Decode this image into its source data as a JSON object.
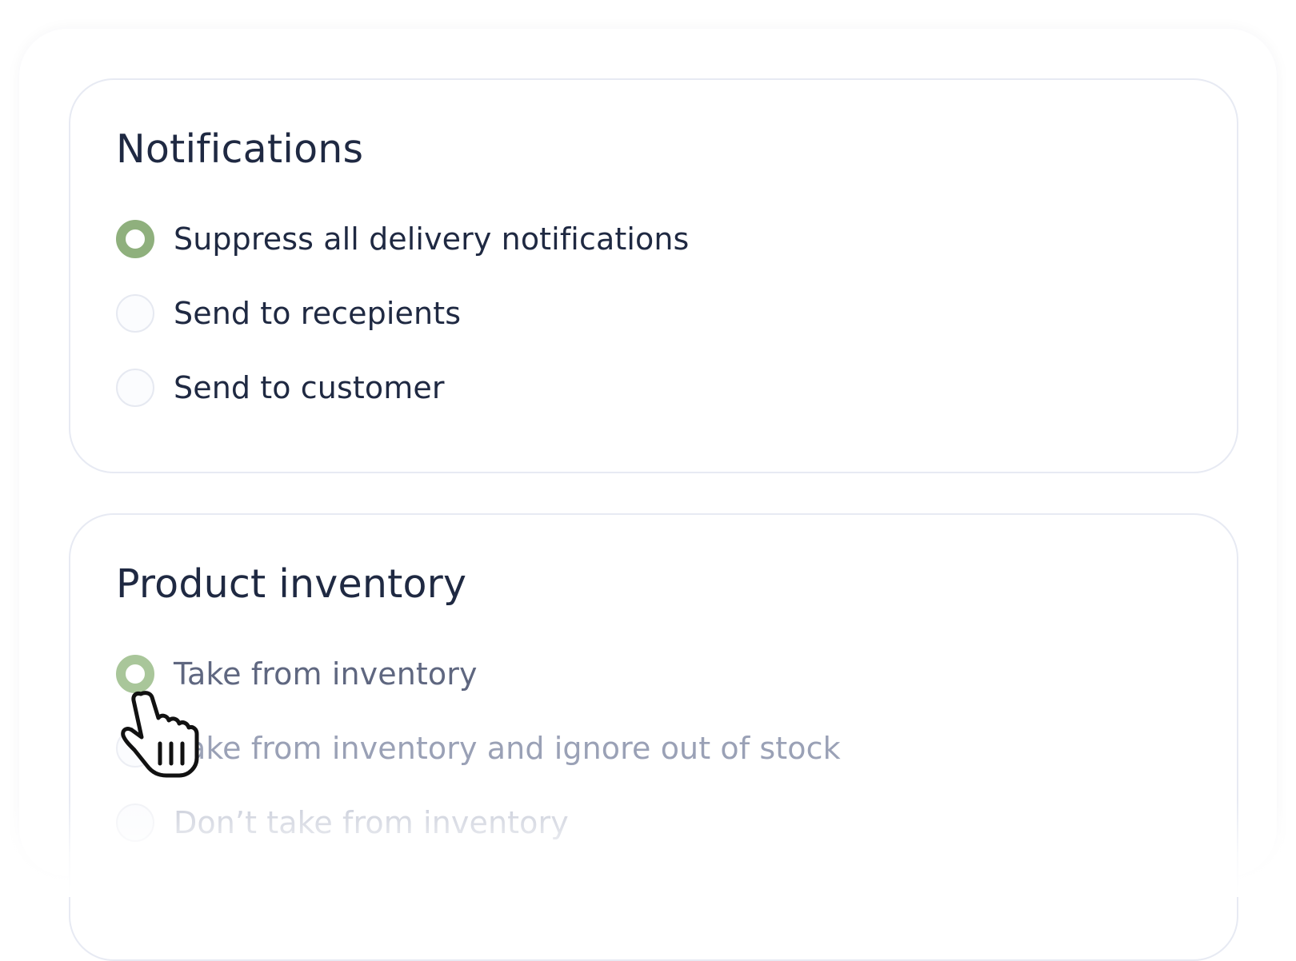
{
  "notifications": {
    "title": "Notifications",
    "options": [
      {
        "label": "Suppress all delivery notifications",
        "selected": true
      },
      {
        "label": "Send to recepients",
        "selected": false
      },
      {
        "label": "Send to customer",
        "selected": false
      }
    ]
  },
  "inventory": {
    "title": "Product inventory",
    "options": [
      {
        "label": "Take from inventory",
        "selected": true
      },
      {
        "label": "Take from inventory and ignore out of stock",
        "selected": false
      },
      {
        "label": "Don’t take from inventory",
        "selected": false
      }
    ]
  },
  "colors": {
    "accent": "#8fb07d",
    "text": "#1f2942",
    "card_border": "#e7eaf3"
  },
  "cursor": {
    "icon": "hand-pointer-icon"
  }
}
